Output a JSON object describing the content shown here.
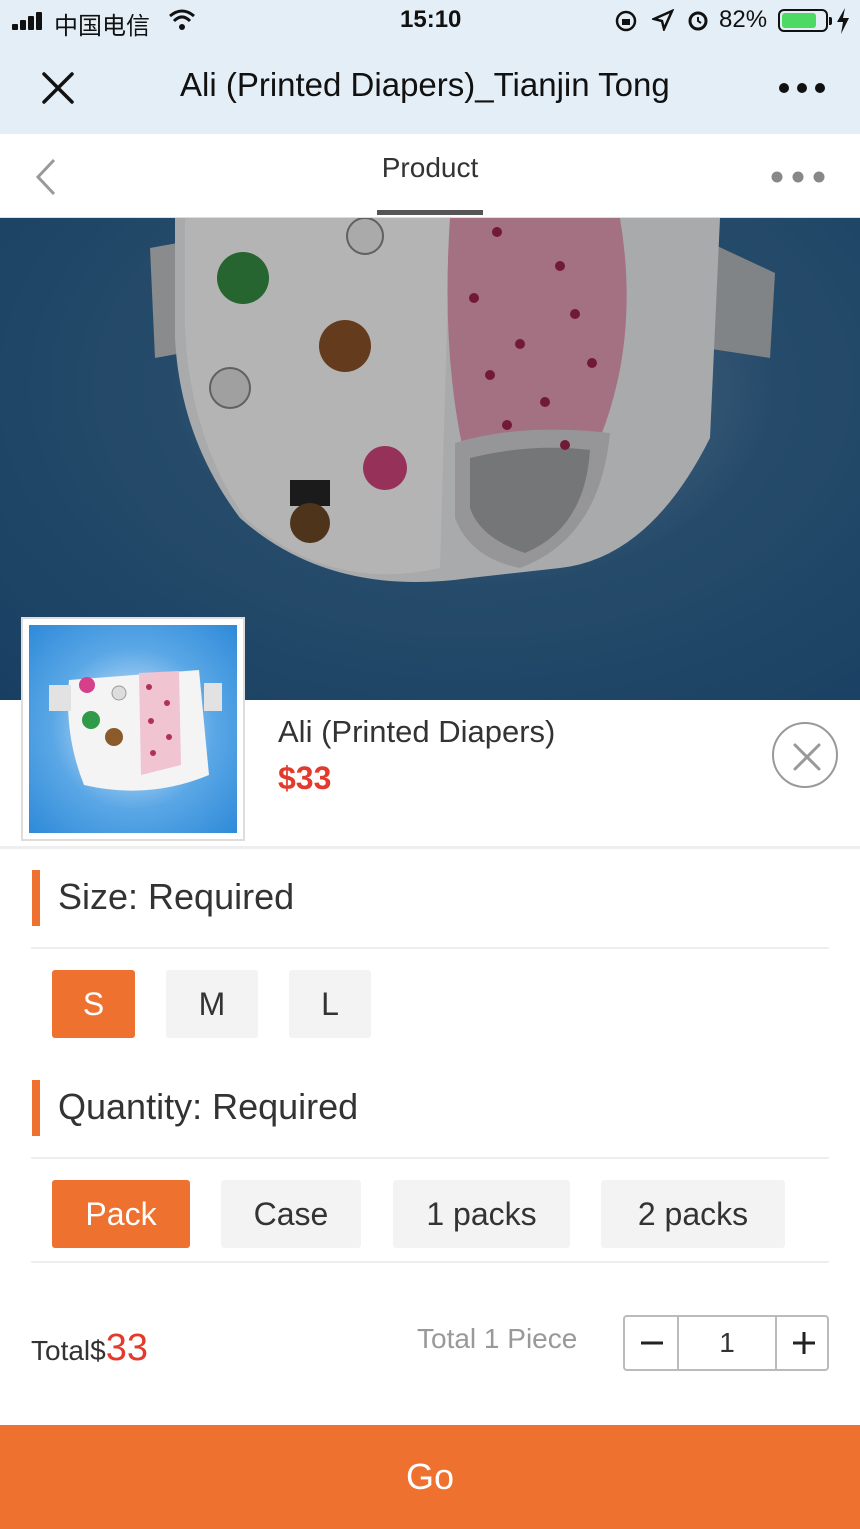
{
  "status_bar": {
    "carrier": "中国电信",
    "time": "15:10",
    "battery_percent": "82%",
    "battery_level": 0.82
  },
  "title_bar": {
    "title": "Ali (Printed Diapers)_Tianjin Tong"
  },
  "nav": {
    "tab_label": "Product"
  },
  "product": {
    "name": "Ali (Printed Diapers)",
    "price": "$33"
  },
  "size": {
    "heading": "Size: Required",
    "options": [
      "S",
      "M",
      "L"
    ],
    "selected": "S"
  },
  "quantity": {
    "heading": "Quantity: Required",
    "options": [
      "Pack",
      "Case",
      "1 packs",
      "2 packs"
    ],
    "selected": "Pack"
  },
  "summary": {
    "total_prefix": "Total$",
    "total_amount": "33",
    "total_pieces": "Total 1 Piece",
    "count": "1"
  },
  "actions": {
    "go_label": "Go"
  },
  "colors": {
    "accent": "#ee7130",
    "price": "#e33a2b",
    "header_bg": "#e4eef6"
  }
}
